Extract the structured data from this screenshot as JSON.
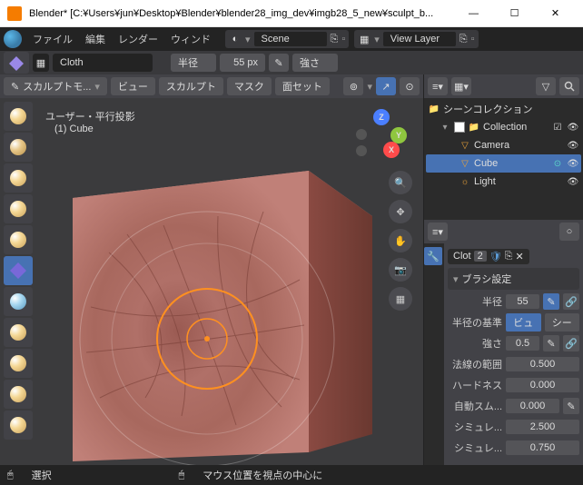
{
  "window": {
    "title": "Blender* [C:¥Users¥jun¥Desktop¥Blender¥blender28_img_dev¥imgb28_5_new¥sculpt_b..."
  },
  "win_controls": {
    "min": "—",
    "max": "☐",
    "close": "✕"
  },
  "topmenu": {
    "file": "ファイル",
    "edit": "編集",
    "render": "レンダー",
    "window": "ウィンド"
  },
  "scene": {
    "label": "Scene"
  },
  "viewlayer": {
    "label": "View Layer"
  },
  "header": {
    "brush_name": "Cloth",
    "radius_label": "半径",
    "radius_value": "55 px",
    "strength_label": "強さ"
  },
  "vp": {
    "mode": "スカルプトモ...",
    "view": "ビュー",
    "sculpt": "スカルプト",
    "mask": "マスク",
    "faceset": "面セット",
    "overlay_title": "ユーザー・平行投影",
    "overlay_obj": "(1) Cube"
  },
  "axes": {
    "x": "X",
    "y": "Y",
    "z": "Z"
  },
  "outliner": {
    "scene_collection": "シーンコレクション",
    "collection": "Collection",
    "camera": "Camera",
    "cube": "Cube",
    "light": "Light"
  },
  "props": {
    "brush_chip": "Clot",
    "brush_num": "2",
    "panel": "ブラシ設定",
    "radius_label": "半径",
    "radius_val": "55",
    "radius_basis": "半径の基準",
    "radius_basis_a": "ビュ",
    "radius_basis_b": "シー",
    "strength_label": "強さ",
    "strength_val": "0.5",
    "normal_label": "法線の範囲",
    "normal_val": "0.500",
    "hardness_label": "ハードネス",
    "hardness_val": "0.000",
    "autosmooth_label": "自動スム...",
    "autosmooth_val": "0.000",
    "sim1_label": "シミュレ...",
    "sim1_val": "2.500",
    "sim2_label": "シミュレ...",
    "sim2_val": "0.750"
  },
  "status": {
    "select": "選択",
    "center": "マウス位置を視点の中心に"
  }
}
